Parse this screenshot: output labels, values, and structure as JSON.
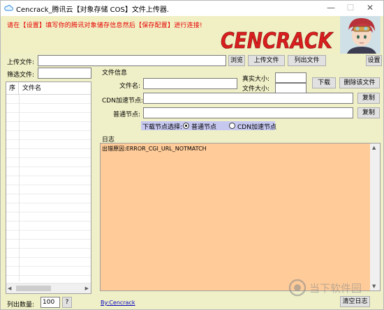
{
  "window": {
    "title": "Cencrack_腾讯云【对象存储 COS】文件上传器.",
    "controls": {
      "minimize": "—",
      "maximize": "☐",
      "close": "✕"
    }
  },
  "banner": {
    "message": "请在【设置】填写你的腾讯对象储存信息然后【保存配置】进行连接!",
    "logo_text": "CENCRACK",
    "logo_color": "#d81e1e"
  },
  "upload": {
    "label": "上传文件:",
    "value": "",
    "browse_button": "浏览",
    "upload_button": "上传文件",
    "list_button": "列出文件",
    "settings_button": "设置"
  },
  "filter": {
    "label": "筛选文件:",
    "value": ""
  },
  "file_list": {
    "columns": [
      "序",
      "文件名"
    ],
    "rows": []
  },
  "list_count": {
    "label": "列出数量:",
    "value": "100",
    "help_button": "?"
  },
  "file_info": {
    "group_title": "文件信息",
    "filename_label": "文件名:",
    "filename_value": "",
    "real_size_label": "真实大小:",
    "file_size_label": "文件大小:",
    "real_size_value": "",
    "file_size_value": "",
    "download_button": "下载",
    "delete_button": "删除该文件",
    "cdn_label": "CDN加速节点:",
    "cdn_value": "",
    "cdn_copy_button": "复制",
    "normal_label": "普通节点:",
    "normal_value": "",
    "normal_copy_button": "复制",
    "node_select_label": "下载节点选择:",
    "node_options": [
      "普通节点",
      "CDN加速节点"
    ],
    "node_selected": "普通节点"
  },
  "log": {
    "title": "日志",
    "text": "出错原因:ERROR_CGI_URL_NOTMATCH",
    "clear_button": "清空日志"
  },
  "footer": {
    "author_link": "By:Cencrack"
  },
  "watermark": {
    "text": "当下软件园"
  }
}
